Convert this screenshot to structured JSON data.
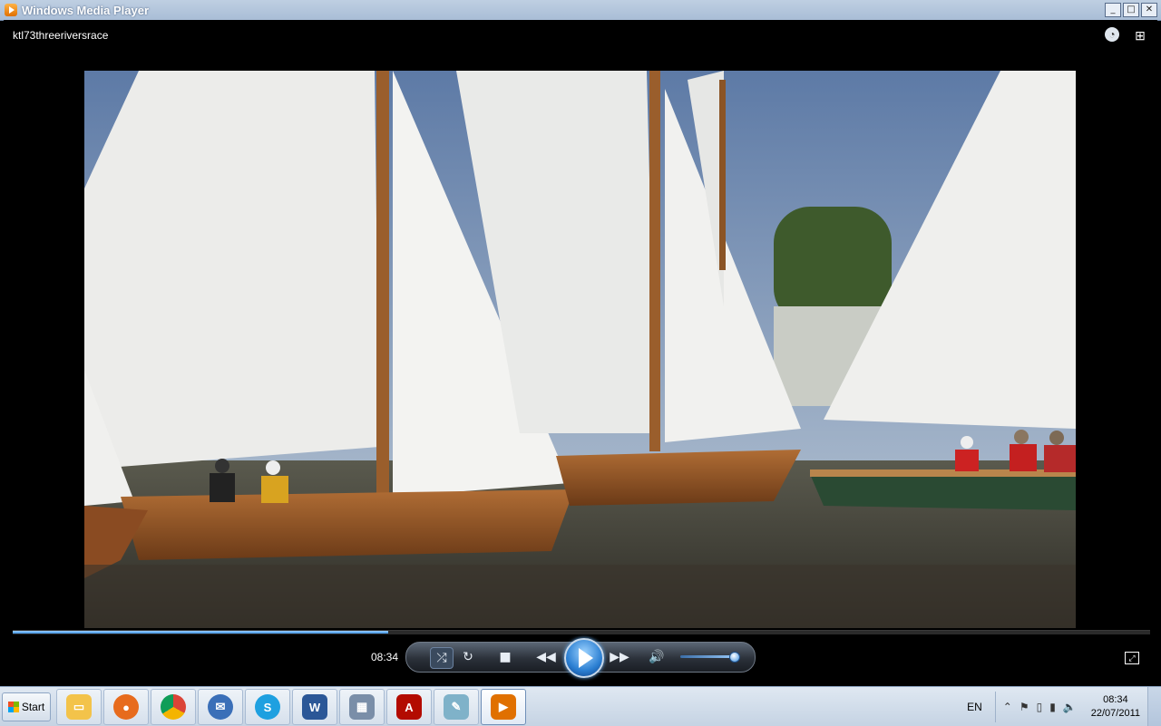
{
  "window": {
    "title": "Windows Media Player",
    "minimize": "_",
    "maximize": "□",
    "close": "✕"
  },
  "player": {
    "media_title": "ktl73threeriversrace",
    "time": "08:34",
    "progress_fraction": 0.33,
    "volume_fraction": 0.9,
    "icons": [
      "switch-to-library-icon",
      "compact-mode-icon"
    ]
  },
  "controls": {
    "shuffle": "⤮",
    "repeat": "↻",
    "stop": "■",
    "previous": "◀◀",
    "next": "▶▶",
    "mute": "🔊",
    "fullscreen": "⤢"
  },
  "taskbar": {
    "start_label": "Start",
    "apps": [
      {
        "name": "windows-explorer",
        "color": "#f3c34a",
        "glyph": "📁"
      },
      {
        "name": "firefox",
        "color": "#e76b1d",
        "glyph": "●"
      },
      {
        "name": "chrome",
        "color": "#3a9c45",
        "glyph": "◉"
      },
      {
        "name": "thunderbird",
        "color": "#3a6fb8",
        "glyph": "✉"
      },
      {
        "name": "skype",
        "color": "#1ea0e0",
        "glyph": "S"
      },
      {
        "name": "word",
        "color": "#2b5797",
        "glyph": "W"
      },
      {
        "name": "calculator",
        "color": "#7a8ea8",
        "glyph": "▦"
      },
      {
        "name": "acrobat-reader",
        "color": "#b30b00",
        "glyph": "A"
      },
      {
        "name": "notepad",
        "color": "#7fb2c9",
        "glyph": "✎"
      },
      {
        "name": "windows-media-player",
        "color": "#e07000",
        "glyph": "▶"
      }
    ],
    "language": "EN",
    "clock_time": "08:34",
    "clock_date": "22/07/2011"
  }
}
